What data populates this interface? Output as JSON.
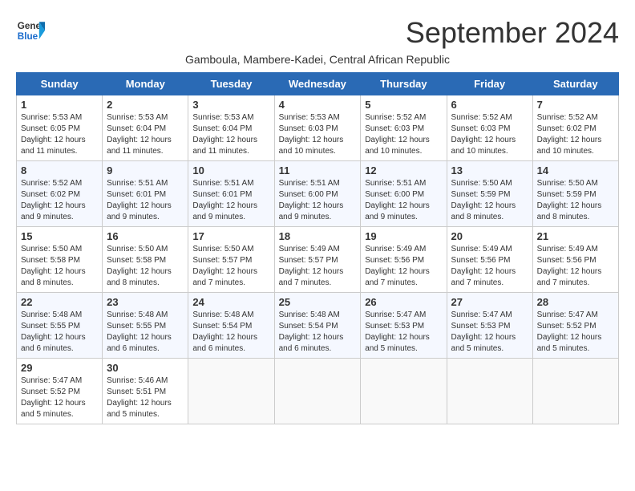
{
  "header": {
    "logo_line1": "General",
    "logo_line2": "Blue",
    "month_title": "September 2024",
    "subtitle": "Gamboula, Mambere-Kadei, Central African Republic"
  },
  "weekdays": [
    "Sunday",
    "Monday",
    "Tuesday",
    "Wednesday",
    "Thursday",
    "Friday",
    "Saturday"
  ],
  "weeks": [
    [
      {
        "day": "1",
        "sunrise": "5:53 AM",
        "sunset": "6:05 PM",
        "daylight": "12 hours and 11 minutes."
      },
      {
        "day": "2",
        "sunrise": "5:53 AM",
        "sunset": "6:04 PM",
        "daylight": "12 hours and 11 minutes."
      },
      {
        "day": "3",
        "sunrise": "5:53 AM",
        "sunset": "6:04 PM",
        "daylight": "12 hours and 11 minutes."
      },
      {
        "day": "4",
        "sunrise": "5:53 AM",
        "sunset": "6:03 PM",
        "daylight": "12 hours and 10 minutes."
      },
      {
        "day": "5",
        "sunrise": "5:52 AM",
        "sunset": "6:03 PM",
        "daylight": "12 hours and 10 minutes."
      },
      {
        "day": "6",
        "sunrise": "5:52 AM",
        "sunset": "6:03 PM",
        "daylight": "12 hours and 10 minutes."
      },
      {
        "day": "7",
        "sunrise": "5:52 AM",
        "sunset": "6:02 PM",
        "daylight": "12 hours and 10 minutes."
      }
    ],
    [
      {
        "day": "8",
        "sunrise": "5:52 AM",
        "sunset": "6:02 PM",
        "daylight": "12 hours and 9 minutes."
      },
      {
        "day": "9",
        "sunrise": "5:51 AM",
        "sunset": "6:01 PM",
        "daylight": "12 hours and 9 minutes."
      },
      {
        "day": "10",
        "sunrise": "5:51 AM",
        "sunset": "6:01 PM",
        "daylight": "12 hours and 9 minutes."
      },
      {
        "day": "11",
        "sunrise": "5:51 AM",
        "sunset": "6:00 PM",
        "daylight": "12 hours and 9 minutes."
      },
      {
        "day": "12",
        "sunrise": "5:51 AM",
        "sunset": "6:00 PM",
        "daylight": "12 hours and 9 minutes."
      },
      {
        "day": "13",
        "sunrise": "5:50 AM",
        "sunset": "5:59 PM",
        "daylight": "12 hours and 8 minutes."
      },
      {
        "day": "14",
        "sunrise": "5:50 AM",
        "sunset": "5:59 PM",
        "daylight": "12 hours and 8 minutes."
      }
    ],
    [
      {
        "day": "15",
        "sunrise": "5:50 AM",
        "sunset": "5:58 PM",
        "daylight": "12 hours and 8 minutes."
      },
      {
        "day": "16",
        "sunrise": "5:50 AM",
        "sunset": "5:58 PM",
        "daylight": "12 hours and 8 minutes."
      },
      {
        "day": "17",
        "sunrise": "5:50 AM",
        "sunset": "5:57 PM",
        "daylight": "12 hours and 7 minutes."
      },
      {
        "day": "18",
        "sunrise": "5:49 AM",
        "sunset": "5:57 PM",
        "daylight": "12 hours and 7 minutes."
      },
      {
        "day": "19",
        "sunrise": "5:49 AM",
        "sunset": "5:56 PM",
        "daylight": "12 hours and 7 minutes."
      },
      {
        "day": "20",
        "sunrise": "5:49 AM",
        "sunset": "5:56 PM",
        "daylight": "12 hours and 7 minutes."
      },
      {
        "day": "21",
        "sunrise": "5:49 AM",
        "sunset": "5:56 PM",
        "daylight": "12 hours and 7 minutes."
      }
    ],
    [
      {
        "day": "22",
        "sunrise": "5:48 AM",
        "sunset": "5:55 PM",
        "daylight": "12 hours and 6 minutes."
      },
      {
        "day": "23",
        "sunrise": "5:48 AM",
        "sunset": "5:55 PM",
        "daylight": "12 hours and 6 minutes."
      },
      {
        "day": "24",
        "sunrise": "5:48 AM",
        "sunset": "5:54 PM",
        "daylight": "12 hours and 6 minutes."
      },
      {
        "day": "25",
        "sunrise": "5:48 AM",
        "sunset": "5:54 PM",
        "daylight": "12 hours and 6 minutes."
      },
      {
        "day": "26",
        "sunrise": "5:47 AM",
        "sunset": "5:53 PM",
        "daylight": "12 hours and 5 minutes."
      },
      {
        "day": "27",
        "sunrise": "5:47 AM",
        "sunset": "5:53 PM",
        "daylight": "12 hours and 5 minutes."
      },
      {
        "day": "28",
        "sunrise": "5:47 AM",
        "sunset": "5:52 PM",
        "daylight": "12 hours and 5 minutes."
      }
    ],
    [
      {
        "day": "29",
        "sunrise": "5:47 AM",
        "sunset": "5:52 PM",
        "daylight": "12 hours and 5 minutes."
      },
      {
        "day": "30",
        "sunrise": "5:46 AM",
        "sunset": "5:51 PM",
        "daylight": "12 hours and 5 minutes."
      },
      null,
      null,
      null,
      null,
      null
    ]
  ]
}
